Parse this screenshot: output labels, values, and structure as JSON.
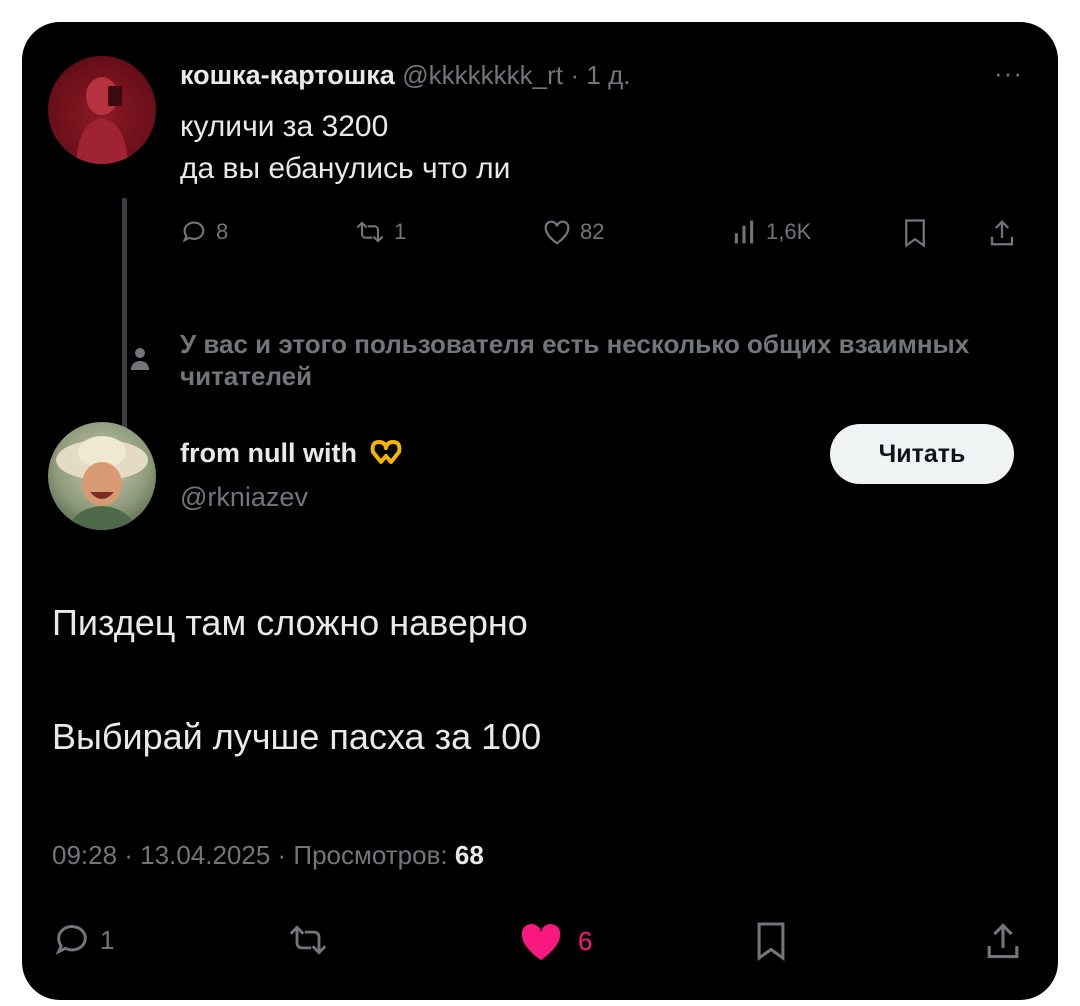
{
  "parent_tweet": {
    "author_name": "кошка-картошка",
    "author_handle": "@kkkkkkkk_rt",
    "time": "· 1 д.",
    "more": "···",
    "lines": [
      "куличи за 3200",
      "да вы ебанулись что ли"
    ],
    "stats": {
      "replies": "8",
      "retweets": "1",
      "likes": "82",
      "views": "1,6K"
    }
  },
  "mutual_notice": "У вас и этого пользователя есть несколько общих взаимных читателей",
  "reply_tweet": {
    "author_name": "from null with",
    "author_emoji": "🫶",
    "author_handle": "@rkniazev",
    "follow_label": "Читать",
    "paragraphs": [
      "Пиздец там сложно наверно",
      "Выбирай лучше пасха за 100"
    ],
    "timestamp": "09:28 · 13.04.2025 · Просмотров:",
    "views": "68",
    "stats": {
      "replies": "1",
      "likes": "6"
    }
  },
  "colors": {
    "background": "#000000",
    "text": "#e7e9ea",
    "secondary": "#71767b",
    "like": "#f91880"
  },
  "icons": [
    "reply-icon",
    "retweet-icon",
    "like-icon",
    "views-icon",
    "bookmark-icon",
    "share-icon",
    "mutual-user-icon",
    "more-icon"
  ]
}
